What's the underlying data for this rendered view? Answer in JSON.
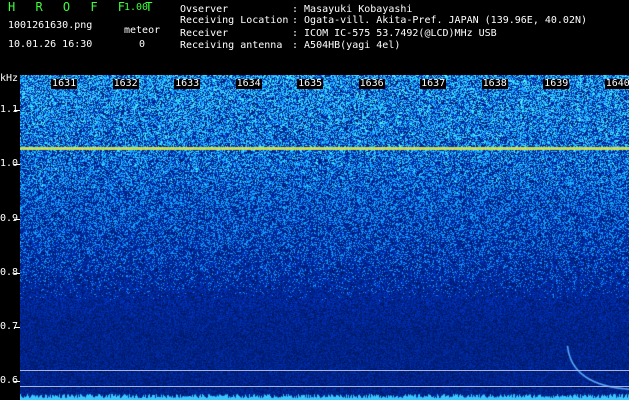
{
  "app": {
    "title": "H R O F F T",
    "version": "1.00"
  },
  "capture": {
    "file_name": "1001261630.png",
    "timestamp": "10.01.26 16:30"
  },
  "meteor": {
    "label": "meteor",
    "count": "0"
  },
  "station": {
    "rows": [
      {
        "key": "Ovserver",
        "value": ": Masayuki Kobayashi"
      },
      {
        "key": "Receiving Location",
        "value": ": Ogata-vill. Akita-Pref. JAPAN (139.96E, 40.02N)"
      },
      {
        "key": "Receiver",
        "value": ": ICOM IC-575 53.7492(@LCD)MHz USB"
      },
      {
        "key": "Receiving antenna",
        "value": ": A504HB(yagi 4el)"
      }
    ]
  },
  "chart_data": {
    "type": "heatmap",
    "ylabel": "kHz",
    "y_ticks": [
      "1.1",
      "1.0",
      "0.9",
      "0.8",
      "0.7",
      "0.6"
    ],
    "x_ticks": [
      "1631",
      "1632",
      "1633",
      "1634",
      "1635",
      "1636",
      "1637",
      "1638",
      "1639",
      "1640"
    ],
    "ylim": [
      0.565,
      1.165
    ],
    "xlim": [
      1630.3,
      1640.2
    ],
    "features": {
      "carrier_line_khz": 1.03,
      "reference_lines_khz": [
        0.62,
        0.59
      ],
      "meteor_trail": {
        "x_start": 1639.2,
        "x_end": 1640.2,
        "khz_start": 0.665,
        "khz_end": 0.585
      }
    },
    "colors": {
      "low": "#001a55",
      "mid": "#1a4aff",
      "high": "#30d8ff",
      "carrier": "#c0e840",
      "noise_floor": "#3cc8ff"
    }
  }
}
